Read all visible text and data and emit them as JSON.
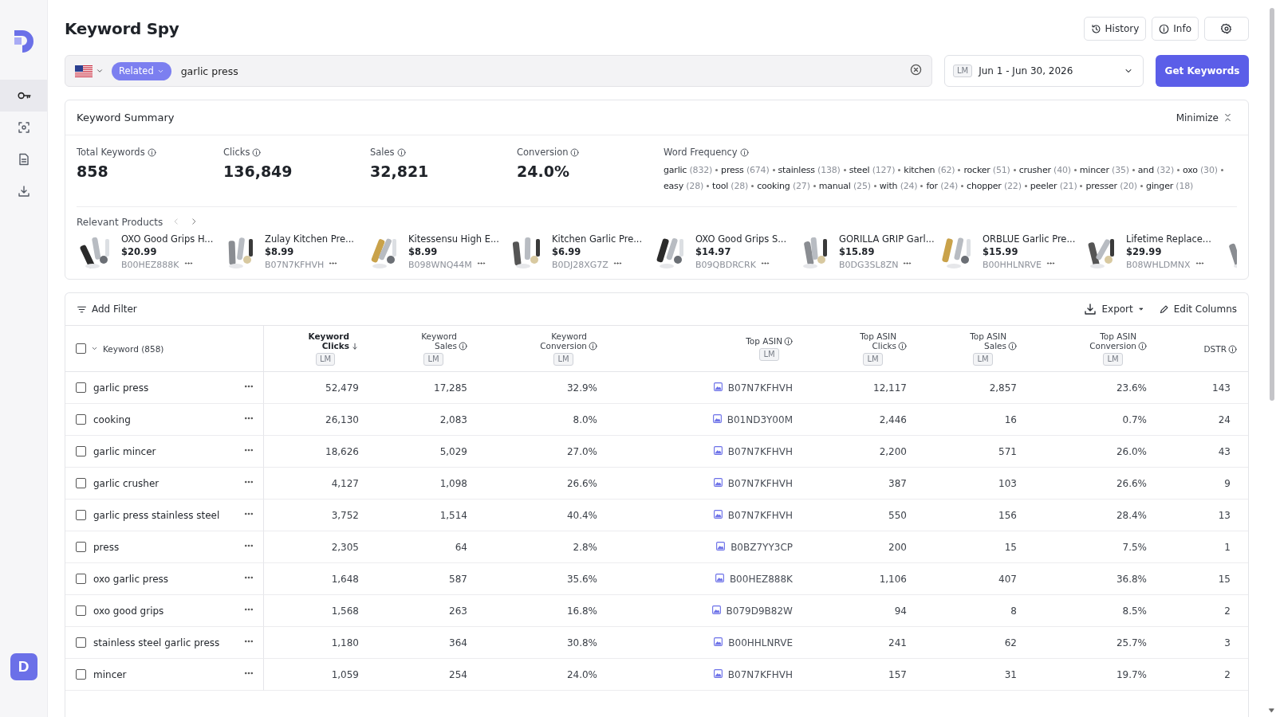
{
  "sidebar": {
    "items": [
      {
        "kind": "key",
        "selected": true
      },
      {
        "kind": "scan",
        "selected": false
      },
      {
        "kind": "document",
        "selected": false
      },
      {
        "kind": "download",
        "selected": false
      }
    ],
    "avatar": "D"
  },
  "header": {
    "title": "Keyword Spy",
    "buttons": [
      {
        "kind": "history",
        "label": "History"
      },
      {
        "kind": "info",
        "label": "Info"
      },
      {
        "kind": "settings"
      }
    ]
  },
  "search": {
    "mode": "Related",
    "value": "garlic press"
  },
  "date_range": {
    "badge": "LM",
    "value": "Jun 1 - Jun 30, 2026"
  },
  "get_button": "Get Keywords",
  "summary": {
    "title": "Keyword Summary",
    "minimize": "Minimize",
    "metrics": [
      {
        "label": "Total Keywords",
        "value": "858"
      },
      {
        "label": "Clicks",
        "value": "136,849"
      },
      {
        "label": "Sales",
        "value": "32,821"
      },
      {
        "label": "Conversion",
        "value": "24.0%"
      }
    ],
    "word_frequency": {
      "label": "Word Frequency",
      "words": [
        {
          "word": "garlic",
          "count": "(832)"
        },
        {
          "word": "press",
          "count": "(674)"
        },
        {
          "word": "stainless",
          "count": "(138)"
        },
        {
          "word": "steel",
          "count": "(127)"
        },
        {
          "word": "kitchen",
          "count": "(62)"
        },
        {
          "word": "rocker",
          "count": "(51)"
        },
        {
          "word": "crusher",
          "count": "(40)"
        },
        {
          "word": "mincer",
          "count": "(35)"
        },
        {
          "word": "and",
          "count": "(32)"
        },
        {
          "word": "oxo",
          "count": "(30)"
        },
        {
          "word": "easy",
          "count": "(28)"
        },
        {
          "word": "tool",
          "count": "(28)"
        },
        {
          "word": "cooking",
          "count": "(27)"
        },
        {
          "word": "manual",
          "count": "(25)"
        },
        {
          "word": "with",
          "count": "(24)"
        },
        {
          "word": "for",
          "count": "(24)"
        },
        {
          "word": "chopper",
          "count": "(22)"
        },
        {
          "word": "peeler",
          "count": "(21)"
        },
        {
          "word": "presser",
          "count": "(20)"
        },
        {
          "word": "ginger",
          "count": "(18)"
        }
      ]
    }
  },
  "products": {
    "label": "Relevant Products",
    "items": [
      {
        "title": "OXO Good Grips H...",
        "price": "$20.99",
        "asin": "B00HEZ888K"
      },
      {
        "title": "Zulay Kitchen Pre...",
        "price": "$8.99",
        "asin": "B07N7KFHVH"
      },
      {
        "title": "Kitessensu High E...",
        "price": "$8.99",
        "asin": "B098WNQ44M"
      },
      {
        "title": "Kitchen Garlic Pre...",
        "price": "$6.99",
        "asin": "B0DJ28XG7Z"
      },
      {
        "title": "OXO Good Grips S...",
        "price": "$14.97",
        "asin": "B09QBDRCRK"
      },
      {
        "title": "GORILLA GRIP Garl...",
        "price": "$15.89",
        "asin": "B0DG3SL8ZN"
      },
      {
        "title": "ORBLUE Garlic Pre...",
        "price": "$15.99",
        "asin": "B00HHLNRVE"
      },
      {
        "title": "Lifetime Replace...",
        "price": "$29.99",
        "asin": "B08WHLDMNX"
      }
    ]
  },
  "table": {
    "toolbar": {
      "filter": "Add Filter",
      "export": "Export",
      "edit": "Edit Columns"
    },
    "select_all": {
      "checked": false
    },
    "columns": [
      {
        "label": "Keyword (858)"
      },
      {
        "label": "Keyword Clicks",
        "badge": "LM",
        "sorted": true,
        "info": false
      },
      {
        "label": "Keyword Sales",
        "badge": "LM",
        "sorted": false,
        "info": true
      },
      {
        "label": "Keyword Conversion",
        "badge": "LM",
        "sorted": false,
        "info": true
      },
      {
        "label": "Top ASIN",
        "badge": "LM",
        "sorted": false,
        "info": true
      },
      {
        "label": "Top ASIN Clicks",
        "badge": "LM",
        "sorted": false,
        "info": true
      },
      {
        "label": "Top ASIN Sales",
        "badge": "LM",
        "sorted": false,
        "info": true
      },
      {
        "label": "Top ASIN Conversion",
        "badge": "LM",
        "sorted": false,
        "info": true
      },
      {
        "label": "DSTR",
        "sorted": false,
        "info": true
      }
    ],
    "rows": [
      {
        "checked": false,
        "cells": [
          "garlic press",
          "52,479",
          "17,285",
          "32.9%",
          "B07N7KFHVH",
          "12,117",
          "2,857",
          "23.6%",
          "143"
        ]
      },
      {
        "checked": false,
        "cells": [
          "cooking",
          "26,130",
          "2,083",
          "8.0%",
          "B01ND3Y00M",
          "2,446",
          "16",
          "0.7%",
          "24"
        ]
      },
      {
        "checked": false,
        "cells": [
          "garlic mincer",
          "18,626",
          "5,029",
          "27.0%",
          "B07N7KFHVH",
          "2,200",
          "571",
          "26.0%",
          "43"
        ]
      },
      {
        "checked": false,
        "cells": [
          "garlic crusher",
          "4,127",
          "1,098",
          "26.6%",
          "B07N7KFHVH",
          "387",
          "103",
          "26.6%",
          "9"
        ]
      },
      {
        "checked": false,
        "cells": [
          "garlic press stainless steel",
          "3,752",
          "1,514",
          "40.4%",
          "B07N7KFHVH",
          "550",
          "156",
          "28.4%",
          "13"
        ]
      },
      {
        "checked": false,
        "cells": [
          "press",
          "2,305",
          "64",
          "2.8%",
          "B0BZ7YY3CP",
          "200",
          "15",
          "7.5%",
          "1"
        ]
      },
      {
        "checked": false,
        "cells": [
          "oxo garlic press",
          "1,648",
          "587",
          "35.6%",
          "B00HEZ888K",
          "1,106",
          "407",
          "36.8%",
          "15"
        ]
      },
      {
        "checked": false,
        "cells": [
          "oxo good grips",
          "1,568",
          "263",
          "16.8%",
          "B079D9B82W",
          "94",
          "8",
          "8.5%",
          "2"
        ]
      },
      {
        "checked": false,
        "cells": [
          "stainless steel garlic press",
          "1,180",
          "364",
          "30.8%",
          "B00HHLNRVE",
          "241",
          "62",
          "25.7%",
          "3"
        ]
      },
      {
        "checked": false,
        "cells": [
          "mincer",
          "1,059",
          "254",
          "24.0%",
          "B07N7KFHVH",
          "157",
          "31",
          "19.7%",
          "2"
        ]
      }
    ]
  }
}
